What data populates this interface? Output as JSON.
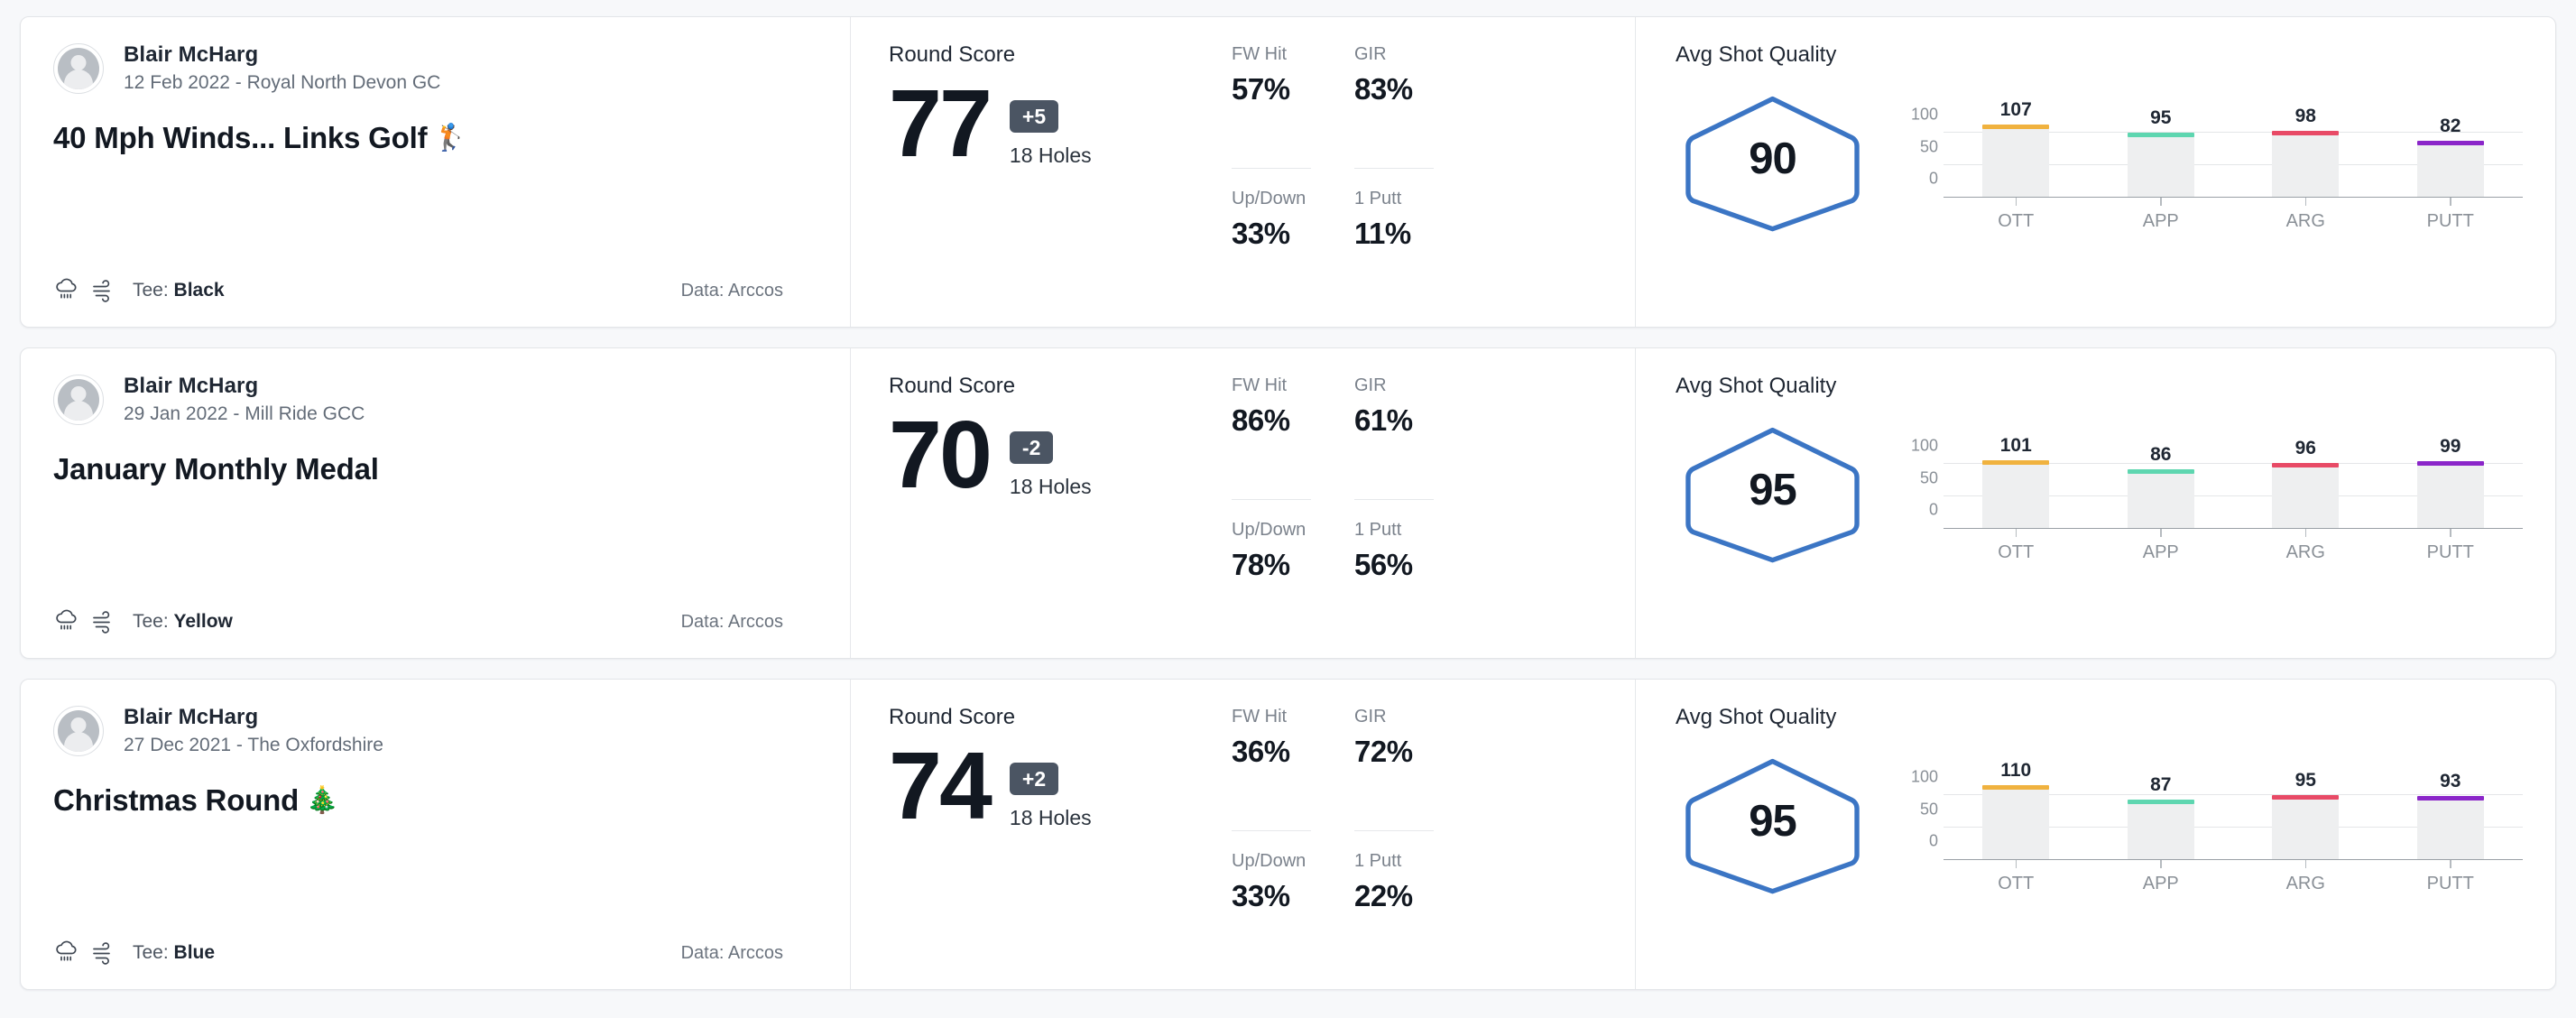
{
  "labels": {
    "round_score": "Round Score",
    "holes": "18 Holes",
    "avg_shot_quality": "Avg Shot Quality",
    "tee_prefix": "Tee: ",
    "fw_hit": "FW Hit",
    "gir": "GIR",
    "up_down": "Up/Down",
    "one_putt": "1 Putt",
    "data_source": "Data: Arccos"
  },
  "colors": {
    "hex_stroke": "#3b75c4",
    "to_par_badge": "#4b5563",
    "ott": "#f0b23f",
    "app": "#5ed6b0",
    "arg": "#e84a66",
    "putt": "#8b26c9",
    "bar_fill": "#eeeff0"
  },
  "chart_axis": {
    "y_ticks": [
      100,
      50,
      0
    ],
    "ymax": 130,
    "categories": [
      "OTT",
      "APP",
      "ARG",
      "PUTT"
    ]
  },
  "cards": [
    {
      "player_name": "Blair McHarg",
      "date_course": "12 Feb 2022 - Royal North Devon GC",
      "title": "40 Mph Winds... Links Golf",
      "title_emoji": "🏌️",
      "tee": "Black",
      "data_source": "Data: Arccos",
      "score": "77",
      "to_par": "+5",
      "holes": "18 Holes",
      "stats": {
        "fw_hit": "57%",
        "gir": "83%",
        "up_down": "33%",
        "one_putt": "11%"
      },
      "shot_quality": "90",
      "chart_data": {
        "type": "bar",
        "title": "Avg Shot Quality",
        "categories": [
          "OTT",
          "APP",
          "ARG",
          "PUTT"
        ],
        "values": [
          107,
          95,
          98,
          82
        ],
        "colors": [
          "#f0b23f",
          "#5ed6b0",
          "#e84a66",
          "#8b26c9"
        ],
        "ylabel": "",
        "xlabel": "",
        "ylim": [
          0,
          130
        ],
        "yticks": [
          0,
          50,
          100
        ],
        "grid": true,
        "legend": "none"
      }
    },
    {
      "player_name": "Blair McHarg",
      "date_course": "29 Jan 2022 - Mill Ride GCC",
      "title": "January Monthly Medal",
      "title_emoji": "",
      "tee": "Yellow",
      "data_source": "Data: Arccos",
      "score": "70",
      "to_par": "-2",
      "holes": "18 Holes",
      "stats": {
        "fw_hit": "86%",
        "gir": "61%",
        "up_down": "78%",
        "one_putt": "56%"
      },
      "shot_quality": "95",
      "chart_data": {
        "type": "bar",
        "title": "Avg Shot Quality",
        "categories": [
          "OTT",
          "APP",
          "ARG",
          "PUTT"
        ],
        "values": [
          101,
          86,
          96,
          99
        ],
        "colors": [
          "#f0b23f",
          "#5ed6b0",
          "#e84a66",
          "#8b26c9"
        ],
        "ylabel": "",
        "xlabel": "",
        "ylim": [
          0,
          130
        ],
        "yticks": [
          0,
          50,
          100
        ],
        "grid": true,
        "legend": "none"
      }
    },
    {
      "player_name": "Blair McHarg",
      "date_course": "27 Dec 2021 - The Oxfordshire",
      "title": "Christmas Round",
      "title_emoji": "🎄",
      "tee": "Blue",
      "data_source": "Data: Arccos",
      "score": "74",
      "to_par": "+2",
      "holes": "18 Holes",
      "stats": {
        "fw_hit": "36%",
        "gir": "72%",
        "up_down": "33%",
        "one_putt": "22%"
      },
      "shot_quality": "95",
      "chart_data": {
        "type": "bar",
        "title": "Avg Shot Quality",
        "categories": [
          "OTT",
          "APP",
          "ARG",
          "PUTT"
        ],
        "values": [
          110,
          87,
          95,
          93
        ],
        "colors": [
          "#f0b23f",
          "#5ed6b0",
          "#e84a66",
          "#8b26c9"
        ],
        "ylabel": "",
        "xlabel": "",
        "ylim": [
          0,
          130
        ],
        "yticks": [
          0,
          50,
          100
        ],
        "grid": true,
        "legend": "none"
      }
    }
  ]
}
